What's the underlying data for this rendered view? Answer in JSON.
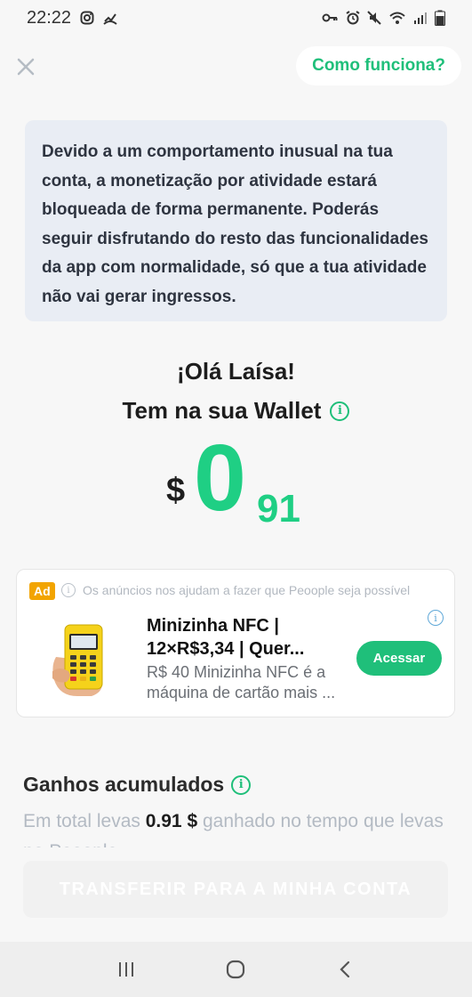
{
  "status_bar": {
    "time": "22:22",
    "icons_left": [
      "instagram-icon",
      "missed-call-icon"
    ],
    "icons_right": [
      "vpn-key-icon",
      "alarm-icon",
      "mute-icon",
      "wifi-icon",
      "signal-icon",
      "battery-icon"
    ]
  },
  "header": {
    "close_icon": "close-icon",
    "how_label": "Como funciona?"
  },
  "notice": {
    "text": "Devido a um comportamento inusual na tua conta, a monetização por atividade estará bloqueada de forma permanente. Poderás seguir disfrutando do resto das funcionalidades da app com normalidade, só que a tua atividade não vai gerar ingressos."
  },
  "greeting": {
    "hello": "¡Olá Laísa!",
    "wallet_label": "Tem na sua Wallet"
  },
  "balance": {
    "currency": "$",
    "integer": "0",
    "decimals": "91"
  },
  "ad": {
    "badge": "Ad",
    "disclaimer": "Os anúncios nos ajudam a fazer que Peoople seja possível",
    "title": "Minizinha NFC | 12×R$3,34 | Quer...",
    "description": "R$ 40 Minizinha NFC é a máquina de cartão mais ...",
    "cta": "Acessar"
  },
  "earnings": {
    "title": "Ganhos acumulados",
    "text_before": "Em total levas ",
    "amount": "0.91 $",
    "text_after": " ganhado no tempo que levas no Peoople"
  },
  "transfer": {
    "label": "TRANSFERIR PARA A MINHA CONTA"
  },
  "nav": {
    "items": [
      "recent-apps-icon",
      "home-icon",
      "back-icon"
    ]
  },
  "colors": {
    "accent": "#1fbf7a",
    "balance_green": "#1fcf84",
    "notice_bg": "#e9edf4",
    "ad_badge": "#f2a400"
  }
}
